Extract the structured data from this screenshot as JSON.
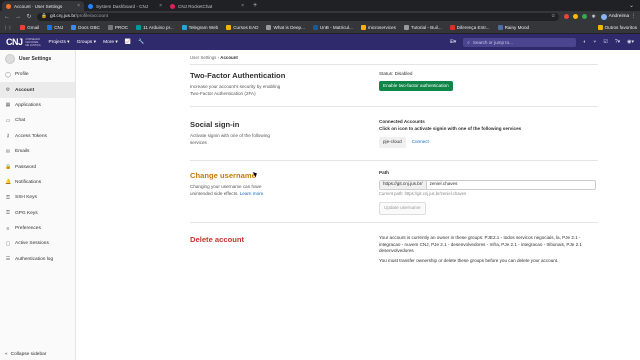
{
  "browser": {
    "tabs": [
      {
        "label": "Account · User Settings",
        "color": "#fc6d26",
        "active": true
      },
      {
        "label": "System Dashboard - CNJ",
        "color": "#2684ff",
        "active": false
      },
      {
        "label": "CNJ RocketChat",
        "color": "#e01e5a",
        "active": false
      }
    ],
    "new_tab": "+",
    "url_host": "git.cnj.jus.br",
    "url_path": "/profile/account",
    "profile_name": "Andreima",
    "bookmarks": [
      {
        "label": "Gmail",
        "color": "#ea4335"
      },
      {
        "label": "CNJ",
        "color": "#1a73e8"
      },
      {
        "label": "Docs GBC",
        "color": "#4285f4"
      },
      {
        "label": "PROC",
        "color": "#777"
      },
      {
        "label": "11 Arduino pr...",
        "color": "#00979d"
      },
      {
        "label": "Telegram Web",
        "color": "#2aa1da"
      },
      {
        "label": "Cursos EAD",
        "color": "#f4b400"
      },
      {
        "label": "What is Deep...",
        "color": "#999"
      },
      {
        "label": "UnB - Matricul...",
        "color": "#1a5a96"
      },
      {
        "label": "microservices",
        "color": "#f4b400"
      },
      {
        "label": "Tutorial - Buil...",
        "color": "#999"
      },
      {
        "label": "Diferença Entr...",
        "color": "#d93025"
      },
      {
        "label": "Rainy Mood",
        "color": "#4a6fa5"
      }
    ],
    "other_bookmarks": "Outros favoritos"
  },
  "gitlab_nav": {
    "logo_text": "CNJ",
    "logo_sub": "CONSELHO NACIONAL DE JUSTIÇA",
    "menus": [
      "Projects ▾",
      "Groups ▾",
      "More ▾"
    ],
    "search_placeholder": "Search or jump to..."
  },
  "sidebar": {
    "user_label": "User Settings",
    "items": [
      {
        "label": "Profile",
        "icon": "user-icon",
        "glyph": "◯",
        "active": false
      },
      {
        "label": "Account",
        "icon": "gear-icon",
        "glyph": "⚙",
        "active": true
      },
      {
        "label": "Applications",
        "icon": "apps-icon",
        "glyph": "▦",
        "active": false
      },
      {
        "label": "Chat",
        "icon": "chat-icon",
        "glyph": "▭",
        "active": false
      },
      {
        "label": "Access Tokens",
        "icon": "key-icon",
        "glyph": "⚷",
        "active": false
      },
      {
        "label": "Emails",
        "icon": "mail-icon",
        "glyph": "✉",
        "active": false
      },
      {
        "label": "Password",
        "icon": "lock-icon",
        "glyph": "🔒",
        "active": false
      },
      {
        "label": "Notifications",
        "icon": "bell-icon",
        "glyph": "🔔",
        "active": false
      },
      {
        "label": "SSH Keys",
        "icon": "ssh-key-icon",
        "glyph": "⚿",
        "active": false
      },
      {
        "label": "GPG Keys",
        "icon": "gpg-key-icon",
        "glyph": "⚿",
        "active": false
      },
      {
        "label": "Preferences",
        "icon": "sliders-icon",
        "glyph": "≡",
        "active": false
      },
      {
        "label": "Active Sessions",
        "icon": "monitor-icon",
        "glyph": "▢",
        "active": false
      },
      {
        "label": "Authentication log",
        "icon": "log-icon",
        "glyph": "☰",
        "active": false
      }
    ],
    "collapse_label": "Collapse sidebar"
  },
  "breadcrumb": {
    "parent": "User Settings",
    "current": "Account"
  },
  "twofa": {
    "title": "Two-Factor Authentication",
    "desc": "Increase your account's security by enabling Two-Factor Authentication (2FA)",
    "status": "Status: Disabled",
    "button": "Enable two-factor authentication"
  },
  "signin": {
    "title": "Social sign-in",
    "desc": "Activate signin with one of the following services",
    "connected": "Connected Accounts",
    "instruction": "Click on icon to activate signin with one of the following services",
    "provider": "pje-cloud",
    "connect": "Connect"
  },
  "username": {
    "title": "Change username",
    "desc": "Changing your username can have unintended side effects.",
    "learn_more": "Learn more.",
    "path_label": "Path",
    "prefix": "https://git.cnj.jus.br/",
    "value": "zeniel.chaves",
    "current_path": "Current path: https://git.cnj.jus.br/zeniel.chaves",
    "button": "Update username"
  },
  "delete": {
    "title": "Delete account",
    "text": "Your account is currently an owner in these groups: PJE2.1 - todos servicos negociais, la, PJe 2.1 - integracao - nuvem CNJ, PJe 2.1 - desenvolvedores - Infra, PJe 2.1 - integracao - tribunais, PJe 2.1 desenvolvedores",
    "note": "You must transfer ownership or delete these groups before you can delete your account."
  }
}
